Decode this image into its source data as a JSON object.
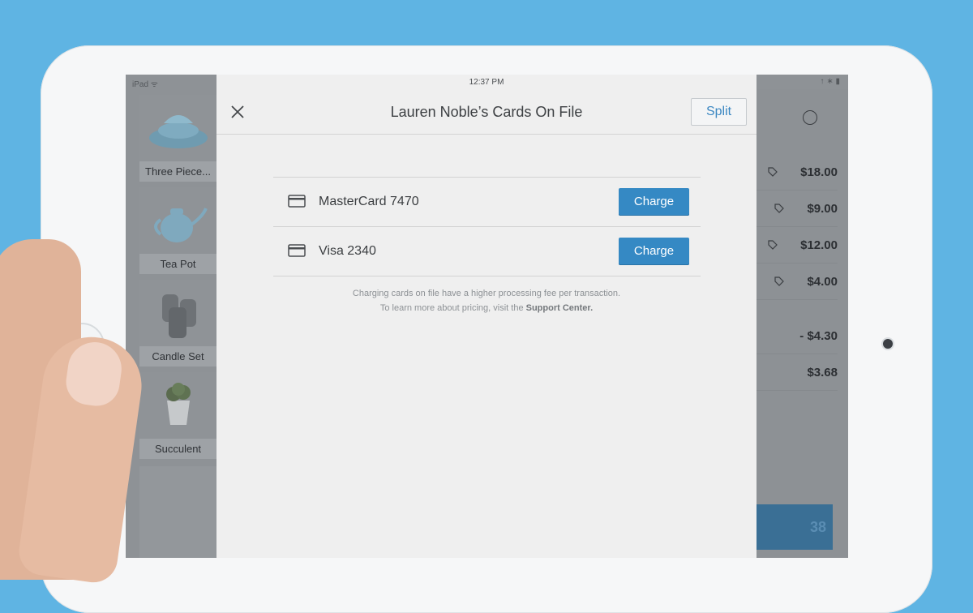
{
  "status_bar": {
    "left": "iPad ᯤ",
    "time": "12:37 PM",
    "right": "↑ ∗ ▮"
  },
  "items": [
    {
      "label": "Three Piece...",
      "icon": "dish-set-icon"
    },
    {
      "label": "Tea Pot",
      "icon": "teapot-icon"
    },
    {
      "label": "Candle Set",
      "icon": "candles-icon"
    },
    {
      "label": "Succulent",
      "icon": "plant-icon"
    }
  ],
  "cart": {
    "rows": [
      {
        "amount": "$18.00",
        "tag": true
      },
      {
        "amount": "$9.00",
        "tag": true
      },
      {
        "amount": "$12.00",
        "tag": true
      },
      {
        "amount": "$4.00",
        "tag": true
      },
      {
        "amount": "- $4.30",
        "tag": false
      },
      {
        "amount": "$3.68",
        "tag": false
      }
    ],
    "charge_partial": "38"
  },
  "modal": {
    "title": "Lauren Noble’s Cards On File",
    "split_label": "Split",
    "cards": [
      {
        "name": "MasterCard 7470",
        "button": "Charge"
      },
      {
        "name": "Visa 2340",
        "button": "Charge"
      }
    ],
    "info_line1": "Charging cards on file have a higher processing fee per transaction.",
    "info_line2_prefix": "To learn more about pricing, visit the ",
    "info_link": "Support Center."
  },
  "colors": {
    "background": "#5fb4e3",
    "primary_button": "#3589c4",
    "split_text": "#3b87c2"
  }
}
